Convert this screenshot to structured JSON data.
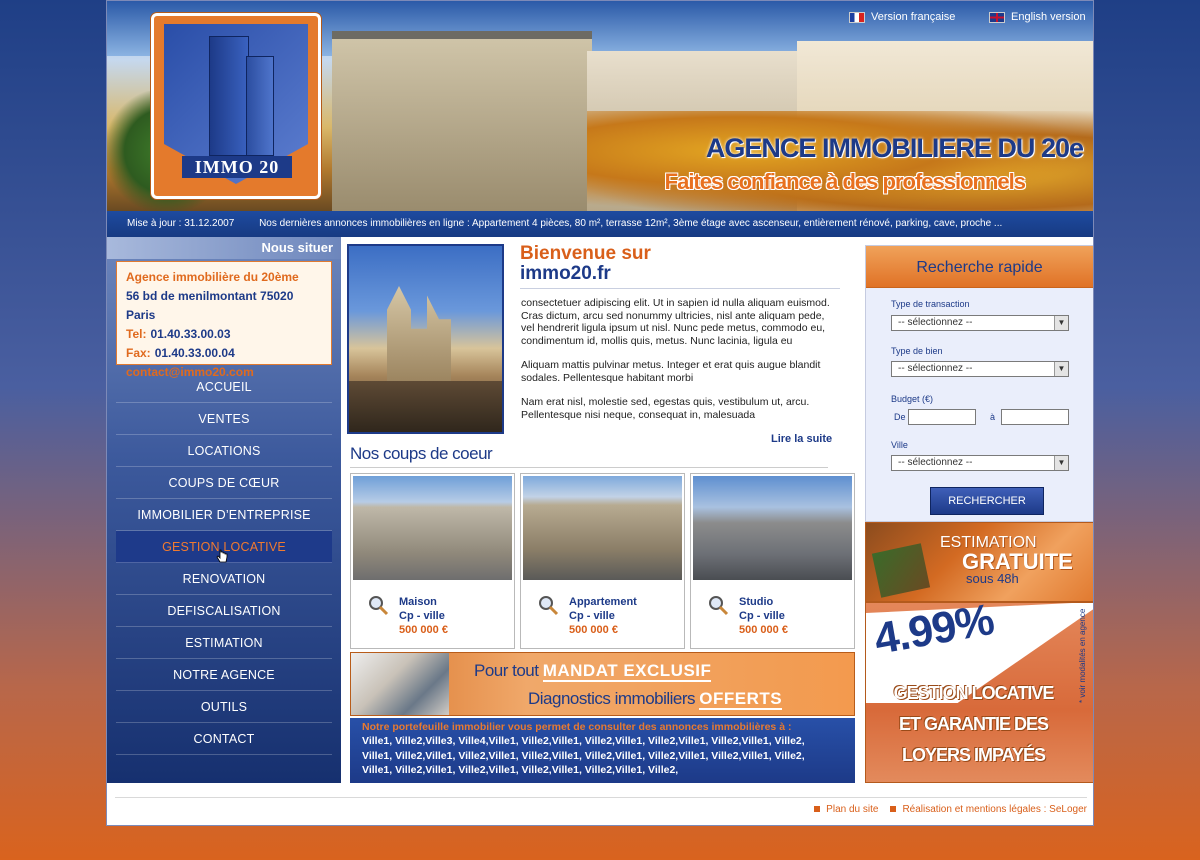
{
  "lang": {
    "fr": "Version française",
    "en": "English version"
  },
  "logo": {
    "text": "IMMO 20"
  },
  "header": {
    "title_part1": "AGENCE IMMOBILIERE DU ",
    "title_part2": "20e",
    "slogan": "Faites confiance à des professionnels"
  },
  "ticker": {
    "update": "Mise à jour : 31.12.2007",
    "text": "Nos dernières annonces immobilières en ligne : Appartement 4 pièces, 80 m², terrasse 12m², 3ème étage avec ascenseur, entièrement rénové, parking, cave, proche ..."
  },
  "sidebar": {
    "header": "Nous situer",
    "contact": {
      "name": "Agence immobilière du 20ème",
      "address": "56 bd de menilmontant 75020 Paris",
      "tel_label": "Tel:",
      "tel": "01.40.33.00.03",
      "fax_label": "Fax:",
      "fax": "01.40.33.00.04",
      "email": "contact@immo20.com"
    },
    "nav": [
      "ACCUEIL",
      "VENTES",
      "LOCATIONS",
      "COUPS DE CŒUR",
      "IMMOBILIER D’ENTREPRISE",
      "GESTION LOCATIVE",
      "RENOVATION",
      "DEFISCALISATION",
      "ESTIMATION",
      "NOTRE AGENCE",
      "OUTILS",
      "CONTACT"
    ]
  },
  "welcome": {
    "line1": "Bienvenue sur",
    "line2": "immo20.fr",
    "p1": "consectetuer adipiscing elit. Ut in sapien id nulla aliquam euismod. Cras dictum, arcu sed nonummy ultricies, nisl ante aliquam pede, vel hendrerit ligula ipsum ut nisl. Nunc pede metus, commodo eu, condimentum id, mollis quis, metus. Nunc lacinia, ligula eu",
    "p2": "Aliquam mattis pulvinar metus. Integer et erat quis augue blandit sodales. Pellentesque habitant morbi",
    "p3": "Nam erat nisl, molestie sed, egestas quis, vestibulum ut, arcu. Pellentesque nisi neque, consequat in, malesuada",
    "read_more": "Lire la suite"
  },
  "coups_title": "Nos coups de coeur",
  "cards": [
    {
      "type": "Maison",
      "location": "Cp - ville",
      "price": "500 000 €"
    },
    {
      "type": "Appartement",
      "location": "Cp - ville",
      "price": "500 000 €"
    },
    {
      "type": "Studio",
      "location": "Cp - ville",
      "price": "500 000 €"
    }
  ],
  "mandat": {
    "l1_pre": "Pour tout ",
    "l1_em": "MANDAT EXCLUSIF",
    "l2_pre": "Diagnostics immobiliers ",
    "l2_em": "OFFERTS"
  },
  "portfolio": {
    "intro": "Notre portefeuille immobilier vous permet de consulter des annonces immobilières à :",
    "line1": "Ville1, Ville2,Ville3, Ville4,Ville1, Ville2,Ville1, Ville2,Ville1, Ville2,Ville1, Ville2,Ville1, Ville2,",
    "line2": "Ville1, Ville2,Ville1, Ville2,Ville1, Ville2,Ville1, Ville2,Ville1, Ville2,Ville1, Ville2,Ville1, Ville2,",
    "line3": "Ville1, Ville2,Ville1, Ville2,Ville1, Ville2,Ville1, Ville2,Ville1, Ville2,"
  },
  "search": {
    "title": "Recherche rapide",
    "transaction_label": "Type de transaction",
    "bien_label": "Type de bien",
    "budget_label": "Budget (€)",
    "from_label": "De",
    "to_label": "à",
    "ville_label": "Ville",
    "select_default": "-- sélectionnez --",
    "button": "RECHERCHER"
  },
  "estimation": {
    "l1": "ESTIMATION",
    "l2": "GRATUITE",
    "l3": "sous 48h"
  },
  "rate": {
    "pct": "4.99%",
    "g1": "GESTION LOCATIVE",
    "g2": "ET GARANTIE DES",
    "g3": "LOYERS IMPAYÉS",
    "note": "* voir modalités en agence"
  },
  "footer": {
    "sitemap": "Plan du site",
    "legal": "Réalisation et mentions légales : SeLoger"
  },
  "colors": {
    "accent_orange": "#d95f1a",
    "brand_blue": "#1d3a88"
  }
}
